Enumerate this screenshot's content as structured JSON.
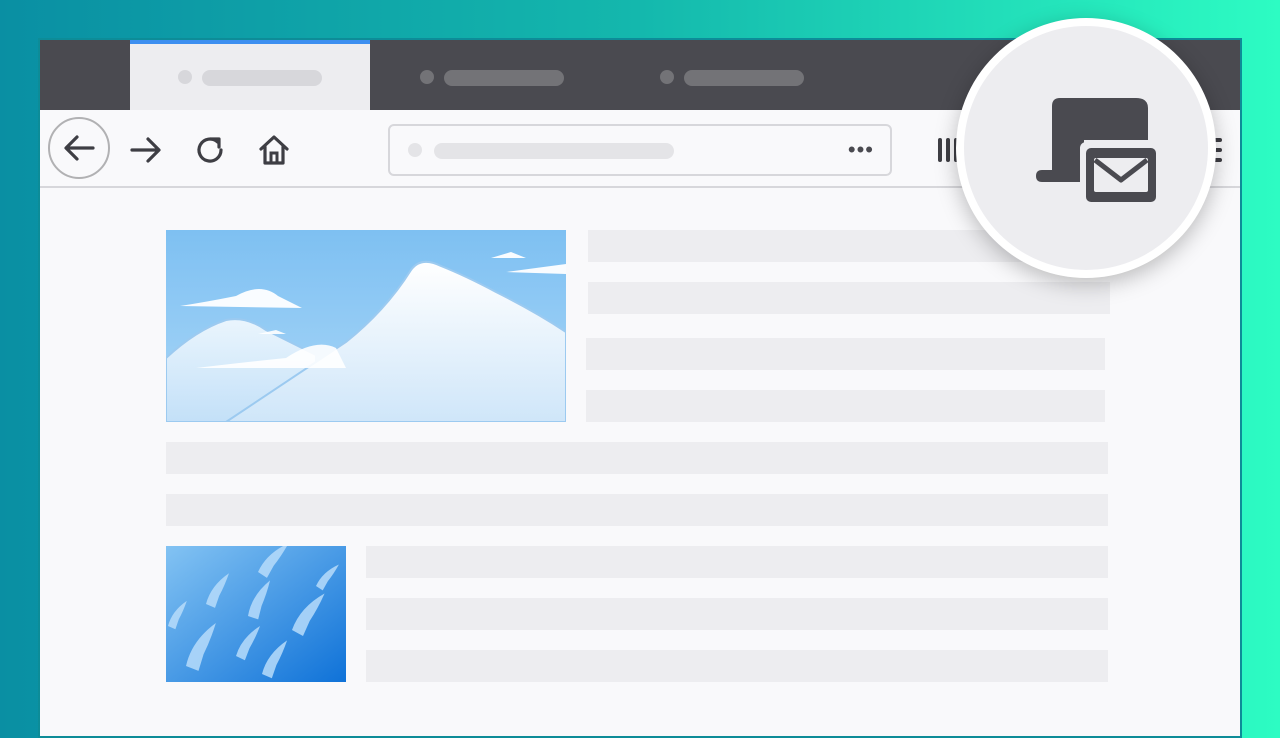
{
  "browser": {
    "tabs": [
      {
        "state": "active"
      },
      {
        "state": "inactive"
      },
      {
        "state": "inactive"
      }
    ],
    "toolbar": {
      "icons": [
        "back-arrow-icon",
        "forward-arrow-icon",
        "reload-icon",
        "home-icon",
        "library-icon",
        "menu-icon"
      ],
      "url_menu_glyph": "•••"
    },
    "feature_icon": "email-link-icon",
    "colors": {
      "background_gradient_start": "#0a8fa3",
      "background_gradient_end": "#2dfcc3",
      "tab_strip": "#4a4a50",
      "active_tab_accent": "#3d8ff0",
      "placeholder": "#ededf0"
    }
  }
}
